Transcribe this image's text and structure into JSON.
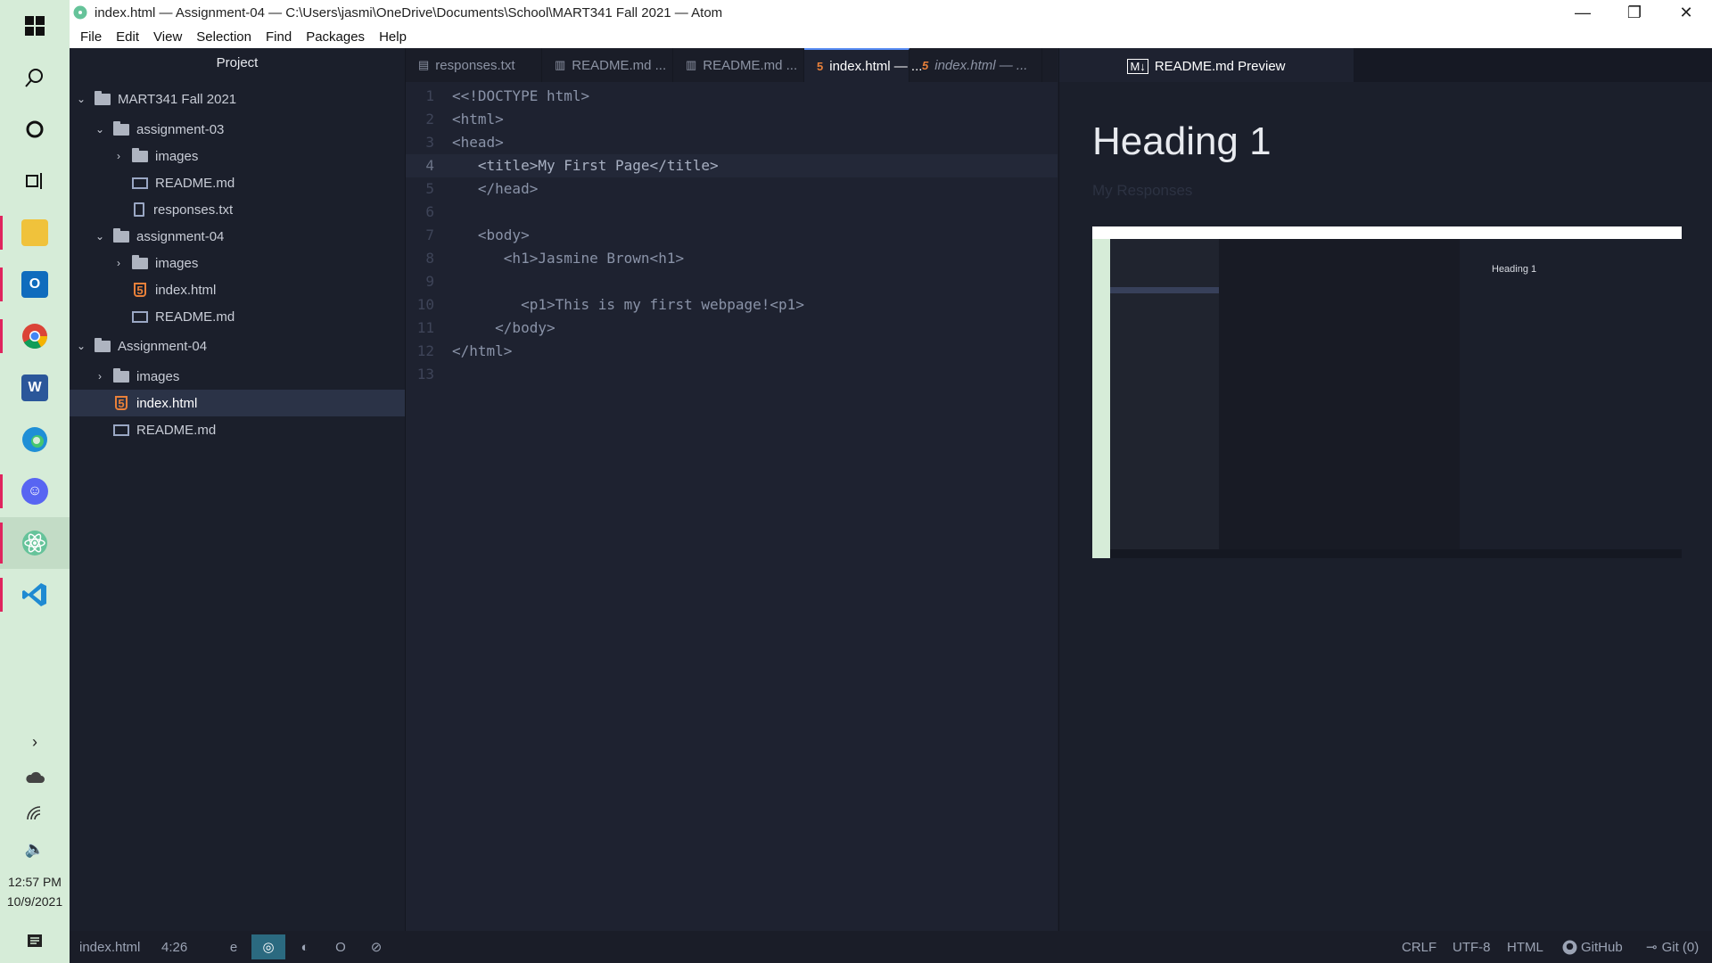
{
  "window": {
    "title": "index.html — Assignment-04 — C:\\Users\\jasmi\\OneDrive\\Documents\\School\\MART341 Fall 2021 — Atom",
    "minimize": "—",
    "maximize": "❐",
    "close": "✕"
  },
  "menu": [
    "File",
    "Edit",
    "View",
    "Selection",
    "Find",
    "Packages",
    "Help"
  ],
  "tree": {
    "header": "Project",
    "rows": [
      {
        "label": "MART341 Fall 2021",
        "type": "folder",
        "open": true
      },
      {
        "label": "assignment-03",
        "type": "folder",
        "open": true
      },
      {
        "label": "images",
        "type": "folder",
        "open": false
      },
      {
        "label": "README.md",
        "type": "md"
      },
      {
        "label": "responses.txt",
        "type": "txt"
      },
      {
        "label": "assignment-04",
        "type": "folder",
        "open": true
      },
      {
        "label": "images",
        "type": "folder",
        "open": false
      },
      {
        "label": "index.html",
        "type": "html"
      },
      {
        "label": "README.md",
        "type": "md"
      },
      {
        "label": "Assignment-04",
        "type": "folder",
        "open": true
      },
      {
        "label": "images",
        "type": "folder",
        "open": false
      },
      {
        "label": "index.html",
        "type": "html",
        "selected": true
      },
      {
        "label": "README.md",
        "type": "md"
      }
    ]
  },
  "tabs": [
    {
      "label": "responses.txt",
      "icon": "txt"
    },
    {
      "label": "README.md ...",
      "icon": "md"
    },
    {
      "label": "README.md ...",
      "icon": "md"
    },
    {
      "label": "index.html — ...",
      "icon": "html",
      "active": true
    },
    {
      "label": "index.html — ...",
      "icon": "html",
      "pending": true
    }
  ],
  "code": {
    "current_line": 4,
    "lines": [
      "<<!DOCTYPE html>",
      "<html>",
      "<head>",
      "   <title>My First Page</title>",
      "   </head>",
      "",
      "   <body>",
      "      <h1>Jasmine Brown<h1>",
      "",
      "        <p1>This is my first webpage!<p1>",
      "     </body>",
      "</html>",
      ""
    ]
  },
  "preview": {
    "tab_label": "README.md Preview",
    "heading": "Heading 1",
    "paragraph": "My Responses",
    "screenshot_heading": "Heading 1"
  },
  "statusbar": {
    "file": "index.html",
    "cursor": "4:26",
    "line_ending": "CRLF",
    "encoding": "UTF-8",
    "grammar": "HTML",
    "github": "GitHub",
    "git": "Git (0)"
  },
  "taskbar": {
    "time": "12:57 PM",
    "date": "10/9/2021"
  },
  "colors": {
    "accent": "#568af2",
    "taskbar_bg": "#d6ecd8",
    "editor_bg": "#1e2230",
    "html_icon": "#e8803a"
  }
}
